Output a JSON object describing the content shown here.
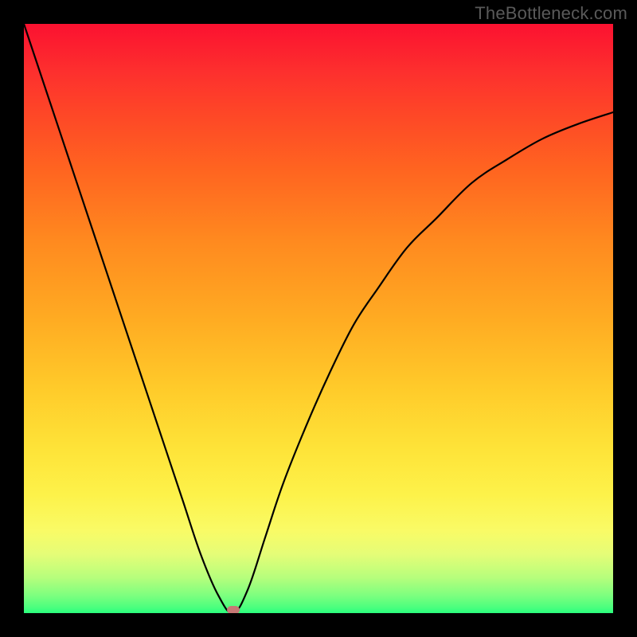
{
  "watermark": "TheBottleneck.com",
  "chart_data": {
    "type": "line",
    "title": "",
    "xlabel": "",
    "ylabel": "",
    "xlim": [
      0,
      100
    ],
    "ylim": [
      0,
      100
    ],
    "grid": false,
    "background_gradient": {
      "top_color": "#fb1130",
      "mid_color": "#ffcb2a",
      "bottom_color": "#2aff7d"
    },
    "series": [
      {
        "name": "bottleneck-curve",
        "x": [
          0,
          3,
          6,
          9,
          12,
          15,
          18,
          21,
          24,
          27,
          30,
          33,
          35.5,
          38,
          41,
          44,
          48,
          52,
          56,
          60,
          65,
          70,
          76,
          82,
          88,
          94,
          100
        ],
        "y": [
          100,
          91,
          82,
          73,
          64,
          55,
          46,
          37,
          28,
          19,
          10,
          3,
          0,
          4,
          13,
          22,
          32,
          41,
          49,
          55,
          62,
          67,
          73,
          77,
          80.5,
          83,
          85
        ]
      }
    ],
    "annotations": [
      {
        "name": "minimum-marker",
        "x": 35.5,
        "y": 0,
        "shape": "pill",
        "color": "#c77875"
      }
    ]
  }
}
